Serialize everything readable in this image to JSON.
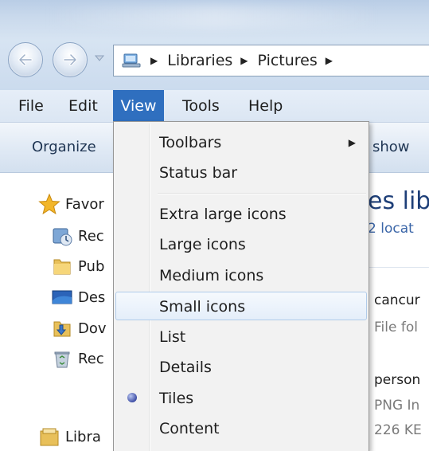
{
  "address": {
    "crumbs": [
      "Libraries",
      "Pictures"
    ]
  },
  "menubar": {
    "file": "File",
    "edit": "Edit",
    "view": "View",
    "tools": "Tools",
    "help": "Help"
  },
  "toolbar": {
    "organize": "Organize",
    "slideshow_partial": "show"
  },
  "nav": {
    "favorites": "Favor",
    "recent": "Rec",
    "public": "Pub",
    "desktop": "Des",
    "downloads": "Dov",
    "recycle": "Rec",
    "libraries": "Libra"
  },
  "content": {
    "title_partial": "es lib",
    "locations_partial": "2 locat",
    "item1_name": "cancur",
    "item1_type": "File fol",
    "item2_name": "person",
    "item2_type": "PNG In",
    "item2_size": "226 KE"
  },
  "view_menu": {
    "toolbars": "Toolbars",
    "status_bar": "Status bar",
    "extra_large_icons": "Extra large icons",
    "large_icons": "Large icons",
    "medium_icons": "Medium icons",
    "small_icons": "Small icons",
    "list": "List",
    "details": "Details",
    "tiles": "Tiles",
    "content": "Content",
    "selected": "Tiles",
    "hovered": "Small icons"
  }
}
